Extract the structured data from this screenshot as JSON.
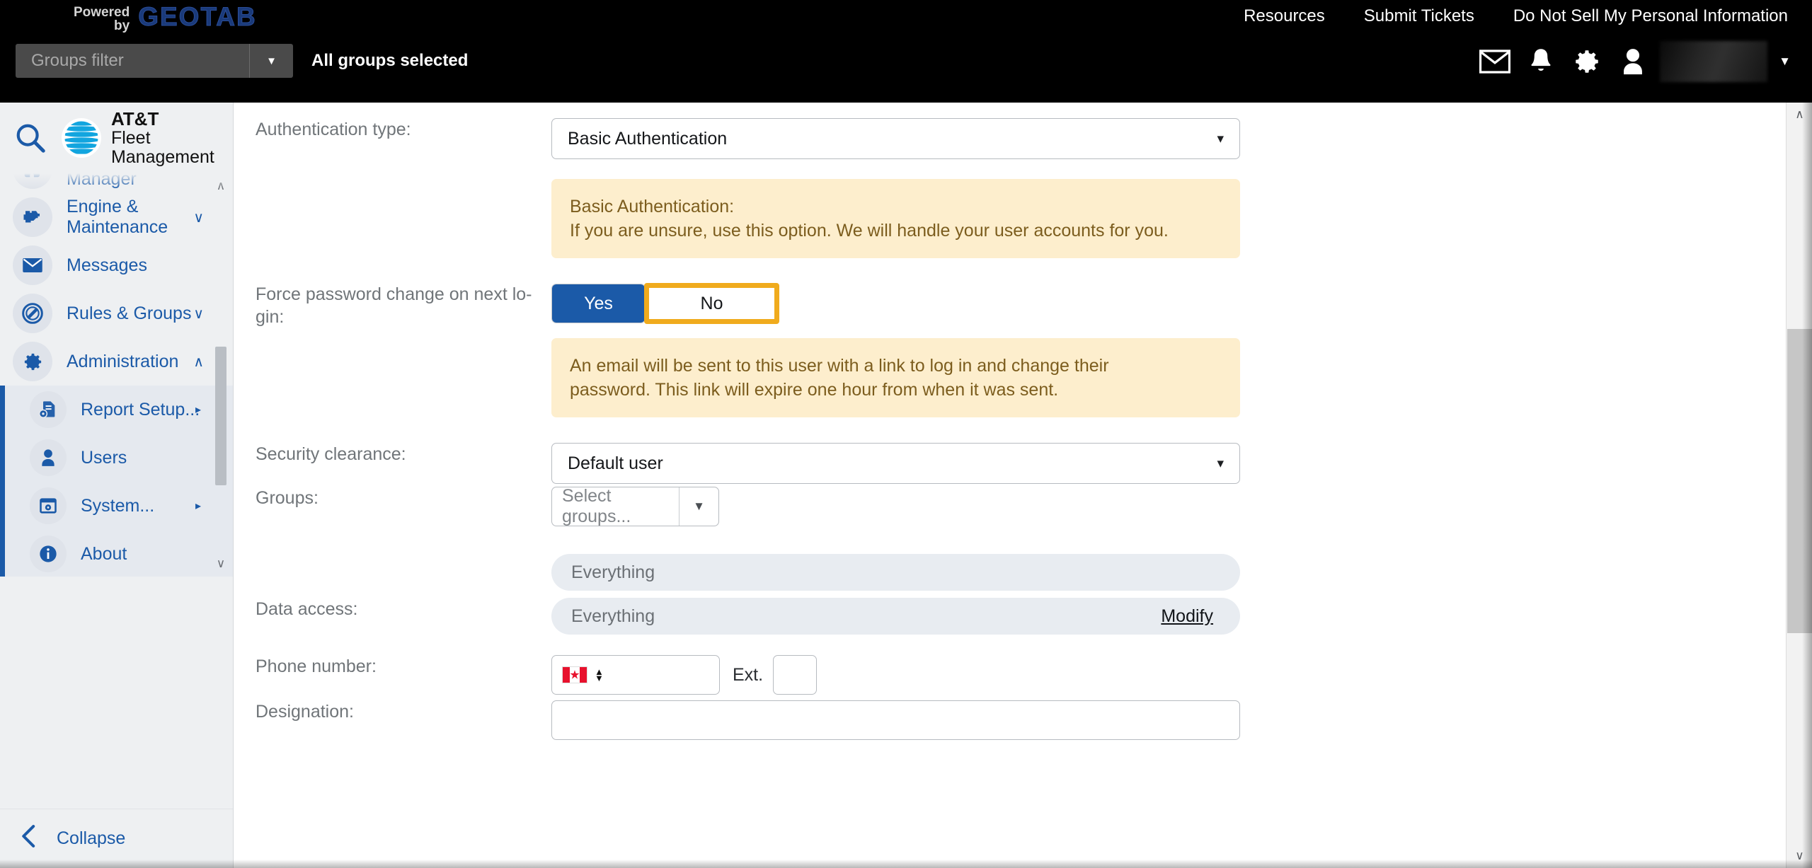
{
  "topbar": {
    "powered": "Powered",
    "by": "by",
    "brand": "GEOTAB",
    "groups_filter_placeholder": "Groups filter",
    "all_groups_selected": "All groups selected",
    "links": [
      {
        "label": "Resources"
      },
      {
        "label": "Submit Tickets"
      },
      {
        "label": "Do Not Sell My Personal Information"
      }
    ],
    "icons": [
      {
        "name": "mail-icon",
        "glyph": "✉"
      },
      {
        "name": "bell-icon",
        "glyph": "🔔"
      },
      {
        "name": "gear-icon",
        "glyph": "⚙"
      },
      {
        "name": "user-icon",
        "glyph": "👤"
      }
    ],
    "account_caret": "▼",
    "colors": {
      "bar_bg": "#000000",
      "brand_blue": "#1a3a7a"
    }
  },
  "sidebar": {
    "search_icon": "search-icon",
    "product_line1": "AT&T",
    "product_line2": "Fleet Management",
    "items": [
      {
        "label": "AT&T Workforce Manager",
        "icon": "puzzle-icon",
        "chevron": "",
        "partial": true
      },
      {
        "label": "Engine & Maintenance",
        "icon": "engine-icon",
        "chevron": "∨"
      },
      {
        "label": "Messages",
        "icon": "envelope-icon",
        "chevron": ""
      },
      {
        "label": "Rules & Groups",
        "icon": "no-entry-icon",
        "chevron": "∨"
      },
      {
        "label": "Administration",
        "icon": "gear-icon",
        "chevron": "∧"
      }
    ],
    "sub_items": [
      {
        "label": "Report Setup...",
        "icon": "report-setup-icon",
        "arrow": "▸"
      },
      {
        "label": "Users",
        "icon": "person-icon",
        "arrow": ""
      },
      {
        "label": "System...",
        "icon": "system-icon",
        "arrow": "▸"
      },
      {
        "label": "About",
        "icon": "info-icon",
        "arrow": ""
      }
    ],
    "collapse_label": "Collapse",
    "collapse_chevron": "‹",
    "scroll_up": "∧",
    "scroll_down": "∨",
    "accent": "#1b5aa8"
  },
  "form": {
    "auth_type": {
      "label": "Authentication type:",
      "value": "Basic Authentication",
      "caret": "⌄"
    },
    "auth_notice": {
      "line1": "Basic Authentication:",
      "line2": "If you are unsure, use this option. We will handle your user accounts for you."
    },
    "force_password": {
      "label": "Force password change on next lo-\ngin:",
      "label_line1": "Force password change on next lo-",
      "label_line2": "gin:",
      "yes": "Yes",
      "no": "No",
      "selected": "Yes",
      "focused": "No",
      "focus_color": "#f0ab1d",
      "selected_color": "#1b5aa8"
    },
    "force_password_notice": {
      "line1": "An email will be sent to this user with a link to log in and change their",
      "line2": "password. This link will expire one hour from when it was sent."
    },
    "security_clearance": {
      "label": "Security clearance:",
      "value": "Default user",
      "caret": "⌄"
    },
    "groups": {
      "label": "Groups:",
      "placeholder": "Select groups...",
      "arrow": "▼",
      "chip": "Everything"
    },
    "data_access": {
      "label": "Data access:",
      "value": "Everything",
      "modify_label": "Modify"
    },
    "phone": {
      "label": "Phone number:",
      "country_flag": "canada-flag",
      "value": "",
      "ext_label": "Ext.",
      "ext_value": ""
    },
    "designation": {
      "label": "Designation:",
      "value": ""
    },
    "notice_bg": "#fdeecd",
    "notice_text": "#7c5d1e"
  },
  "scrollbars": {
    "up": "∧",
    "down": "∨"
  }
}
